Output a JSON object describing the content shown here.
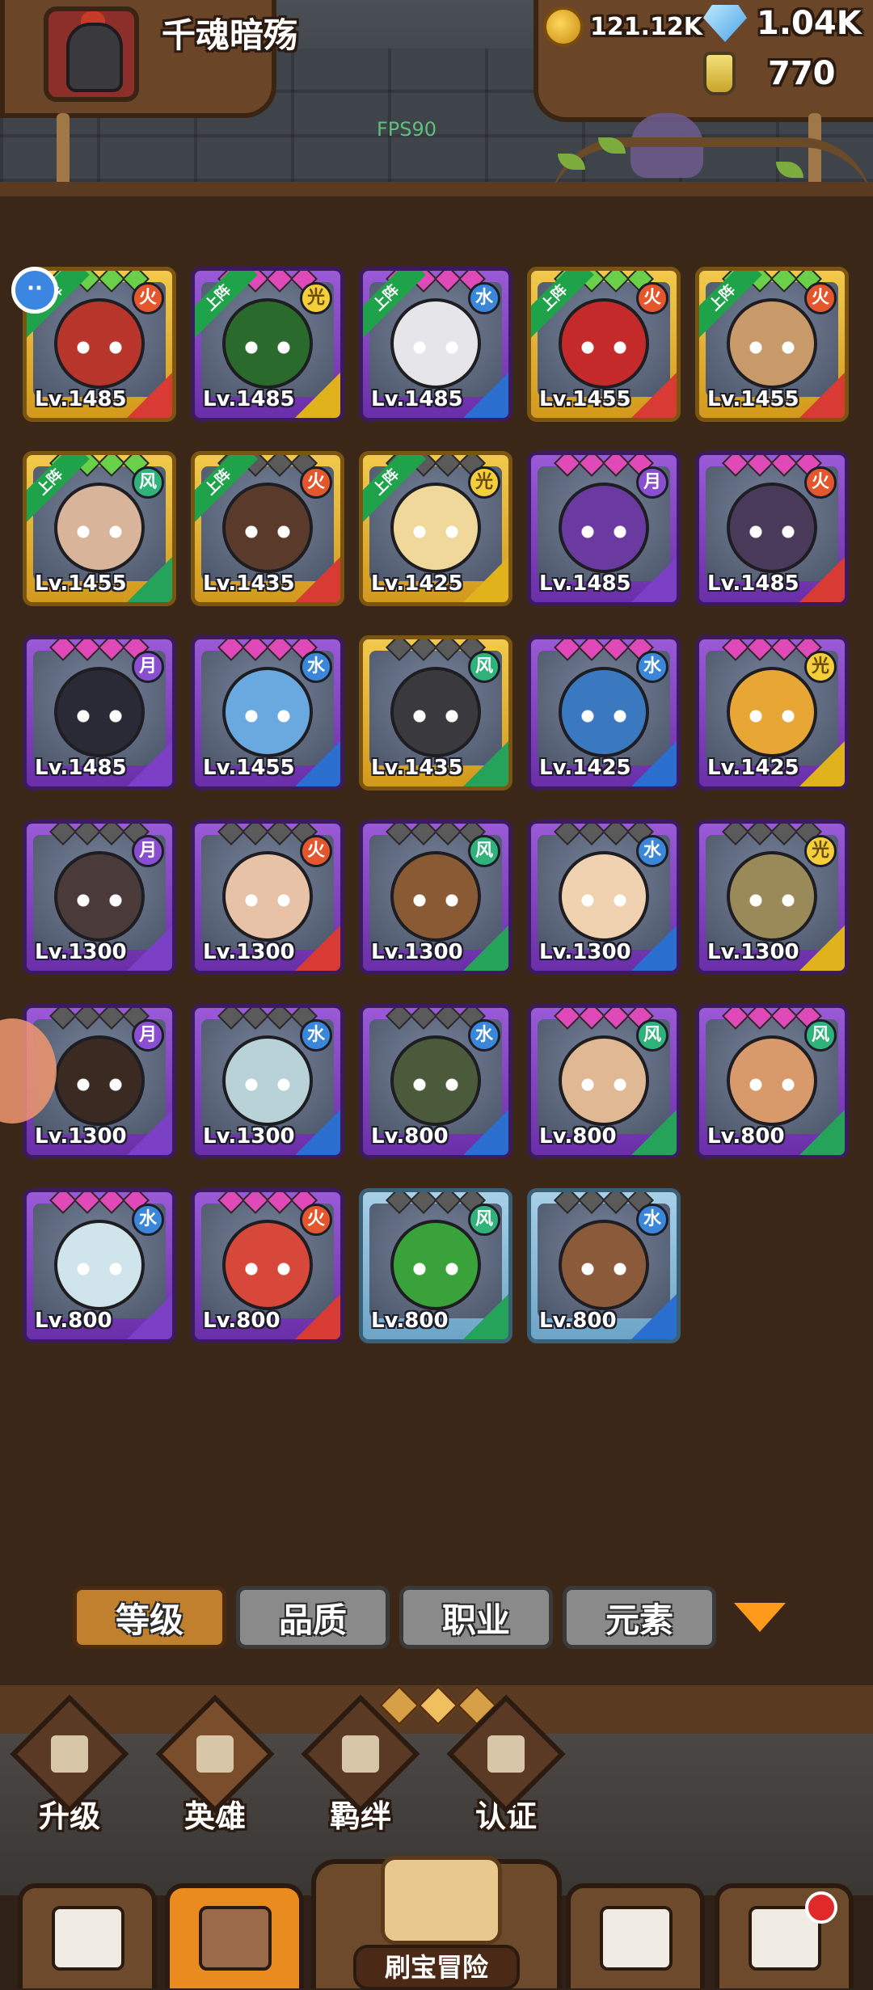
{
  "header": {
    "player_name": "千魂暗殇",
    "gold": "121.12K",
    "gems": "1.04K",
    "potion": "770",
    "fps": "FPS90"
  },
  "heroes": [
    {
      "lv": "Lv.1485",
      "frame": "gold",
      "stars": "green",
      "deployed": true,
      "deploy_label": "上阵",
      "element": "fire",
      "job": "red",
      "face": "#b8352c"
    },
    {
      "lv": "Lv.1485",
      "frame": "purple",
      "stars": "pink",
      "deployed": true,
      "deploy_label": "上阵",
      "element": "light",
      "job": "yellow",
      "face": "#2a6a2c"
    },
    {
      "lv": "Lv.1485",
      "frame": "purple",
      "stars": "pink",
      "deployed": true,
      "deploy_label": "上阵",
      "element": "water",
      "job": "blue",
      "face": "#e6e6ea"
    },
    {
      "lv": "Lv.1455",
      "frame": "gold",
      "stars": "green",
      "deployed": true,
      "deploy_label": "上阵",
      "element": "fire",
      "job": "red",
      "face": "#c42a2a"
    },
    {
      "lv": "Lv.1455",
      "frame": "gold",
      "stars": "green",
      "deployed": true,
      "deploy_label": "上阵",
      "element": "fire",
      "job": "red",
      "face": "#c89a6a"
    },
    {
      "lv": "Lv.1455",
      "frame": "gold",
      "stars": "green",
      "deployed": true,
      "deploy_label": "上阵",
      "element": "wind",
      "job": "green",
      "face": "#d8b49a"
    },
    {
      "lv": "Lv.1435",
      "frame": "gold",
      "stars": "gray",
      "deployed": true,
      "deploy_label": "上阵",
      "element": "fire",
      "job": "red",
      "face": "#5a3a2a"
    },
    {
      "lv": "Lv.1425",
      "frame": "gold",
      "stars": "gray",
      "deployed": true,
      "deploy_label": "上阵",
      "element": "light",
      "job": "yellow",
      "face": "#f0d89a"
    },
    {
      "lv": "Lv.1485",
      "frame": "purple",
      "stars": "pink",
      "deployed": false,
      "deploy_label": "",
      "element": "moon",
      "job": "purple2",
      "face": "#6a3aa0"
    },
    {
      "lv": "Lv.1485",
      "frame": "purple",
      "stars": "pink",
      "deployed": false,
      "deploy_label": "",
      "element": "fire",
      "job": "red",
      "face": "#4a3a5a"
    },
    {
      "lv": "Lv.1485",
      "frame": "purple",
      "stars": "pink",
      "deployed": false,
      "deploy_label": "",
      "element": "moon",
      "job": "purple2",
      "face": "#2a2a36"
    },
    {
      "lv": "Lv.1455",
      "frame": "purple",
      "stars": "pink",
      "deployed": false,
      "deploy_label": "",
      "element": "water",
      "job": "blue",
      "face": "#6aa8e0"
    },
    {
      "lv": "Lv.1435",
      "frame": "gold",
      "stars": "gray",
      "deployed": false,
      "deploy_label": "",
      "element": "wind",
      "job": "green",
      "face": "#3a3a3e"
    },
    {
      "lv": "Lv.1425",
      "frame": "purple",
      "stars": "pink",
      "deployed": false,
      "deploy_label": "",
      "element": "water",
      "job": "blue",
      "face": "#3a78c0"
    },
    {
      "lv": "Lv.1425",
      "frame": "purple",
      "stars": "pink",
      "deployed": false,
      "deploy_label": "",
      "element": "light",
      "job": "yellow",
      "face": "#e8a634"
    },
    {
      "lv": "Lv.1300",
      "frame": "purple",
      "stars": "gray",
      "deployed": false,
      "deploy_label": "",
      "element": "moon",
      "job": "purple2",
      "face": "#4a3a3a"
    },
    {
      "lv": "Lv.1300",
      "frame": "purple",
      "stars": "gray",
      "deployed": false,
      "deploy_label": "",
      "element": "fire",
      "job": "red",
      "face": "#e8c2a6"
    },
    {
      "lv": "Lv.1300",
      "frame": "purple",
      "stars": "gray",
      "deployed": false,
      "deploy_label": "",
      "element": "wind",
      "job": "green",
      "face": "#8a5a34"
    },
    {
      "lv": "Lv.1300",
      "frame": "purple",
      "stars": "gray",
      "deployed": false,
      "deploy_label": "",
      "element": "water",
      "job": "blue",
      "face": "#f0d2b0"
    },
    {
      "lv": "Lv.1300",
      "frame": "purple",
      "stars": "gray",
      "deployed": false,
      "deploy_label": "",
      "element": "light",
      "job": "yellow",
      "face": "#9a8a5a"
    },
    {
      "lv": "Lv.1300",
      "frame": "purple",
      "stars": "gray",
      "deployed": false,
      "deploy_label": "",
      "element": "moon",
      "job": "purple2",
      "face": "#3a2a22"
    },
    {
      "lv": "Lv.1300",
      "frame": "purple",
      "stars": "gray",
      "deployed": false,
      "deploy_label": "",
      "element": "water",
      "job": "blue",
      "face": "#b8d2d8"
    },
    {
      "lv": "Lv.800",
      "frame": "purple",
      "stars": "gray",
      "deployed": false,
      "deploy_label": "",
      "element": "water",
      "job": "blue",
      "face": "#4a5a3a"
    },
    {
      "lv": "Lv.800",
      "frame": "purple",
      "stars": "pink",
      "deployed": false,
      "deploy_label": "",
      "element": "wind",
      "job": "green",
      "face": "#e0b894"
    },
    {
      "lv": "Lv.800",
      "frame": "purple",
      "stars": "pink",
      "deployed": false,
      "deploy_label": "",
      "element": "wind",
      "job": "green",
      "face": "#d89a6a"
    },
    {
      "lv": "Lv.800",
      "frame": "purple",
      "stars": "pink",
      "deployed": false,
      "deploy_label": "",
      "element": "water",
      "job": "purple2",
      "face": "#d0e4ec"
    },
    {
      "lv": "Lv.800",
      "frame": "purple",
      "stars": "pink",
      "deployed": false,
      "deploy_label": "",
      "element": "fire",
      "job": "red",
      "face": "#d8483a"
    },
    {
      "lv": "Lv.800",
      "frame": "blue",
      "stars": "gray",
      "deployed": false,
      "deploy_label": "",
      "element": "wind",
      "job": "green",
      "face": "#3aa23a"
    },
    {
      "lv": "Lv.800",
      "frame": "blue",
      "stars": "gray",
      "deployed": false,
      "deploy_label": "",
      "element": "water",
      "job": "blue",
      "face": "#8a5a3a"
    }
  ],
  "filters": {
    "items": [
      "等级",
      "品质",
      "职业",
      "元素"
    ],
    "active_index": 0
  },
  "sub_nav": [
    {
      "label": "升级",
      "icon": "sword-icon"
    },
    {
      "label": "英雄",
      "icon": "hero-icon"
    },
    {
      "label": "羁绊",
      "icon": "fist-icon"
    },
    {
      "label": "认证",
      "icon": "eye-icon"
    }
  ],
  "main_nav": {
    "adventure_label": "刷宝冒险",
    "tabs": [
      {
        "icon": "shop-icon"
      },
      {
        "icon": "hero-portrait-icon"
      },
      {
        "icon": "chest-icon"
      },
      {
        "icon": "forge-hammer-icon"
      }
    ]
  },
  "colors": {
    "active_filter": "#c0802e",
    "active_tab": "#e98b1e",
    "deploy_tag": "#1fa34a",
    "fps_text": "#5fbf7a"
  }
}
